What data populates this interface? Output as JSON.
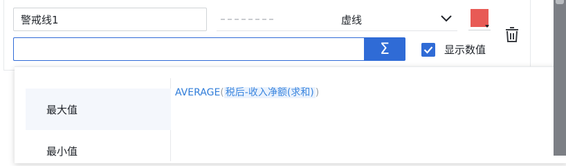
{
  "warning_line": {
    "name_value": "警戒线1",
    "line_style_label": "虚线",
    "line_color": "#e85a55",
    "formula_value": "",
    "sigma_label": "Σ",
    "show_value_checked": true,
    "show_value_label": "显示数值"
  },
  "icons": {
    "style_dropdown": "chevron-down-icon",
    "delete": "trash-icon",
    "checkbox": "check-icon"
  },
  "functions": {
    "items": [
      {
        "label": "最大值"
      },
      {
        "label": "最小值"
      }
    ],
    "active_index": 0
  },
  "expression": {
    "func": "AVERAGE",
    "open": "(",
    "field": "税后-收入净额(求和)",
    "close": ")"
  },
  "colors": {
    "primary": "#2f6bd6",
    "expression": "#2f7cd9"
  }
}
